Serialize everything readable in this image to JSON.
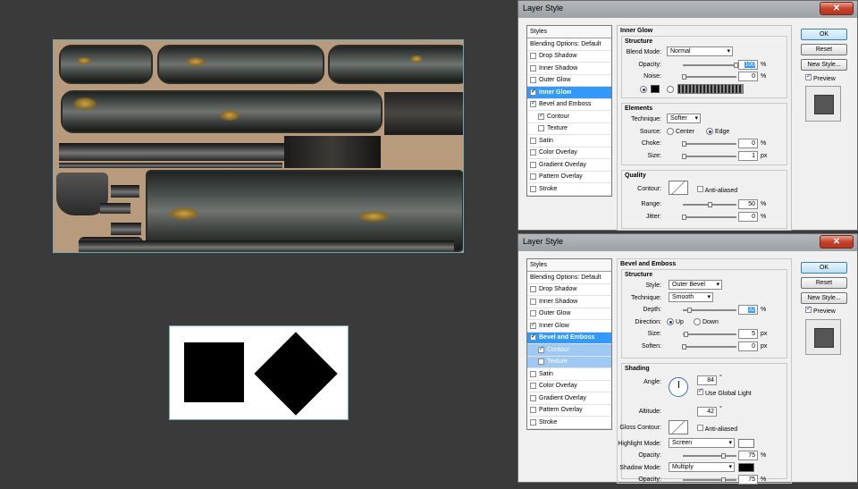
{
  "dialog1": {
    "title": "Layer Style",
    "close": "✕",
    "styles_head": "Styles",
    "items": [
      {
        "label": "Blending Options: Default",
        "check": false,
        "hascb": false
      },
      {
        "label": "Drop Shadow",
        "check": false,
        "hascb": true
      },
      {
        "label": "Inner Shadow",
        "check": false,
        "hascb": true
      },
      {
        "label": "Outer Glow",
        "check": false,
        "hascb": true
      },
      {
        "label": "Inner Glow",
        "check": true,
        "hascb": true,
        "sel": true
      },
      {
        "label": "Bevel and Emboss",
        "check": true,
        "hascb": true
      },
      {
        "label": "Contour",
        "check": true,
        "hascb": true,
        "sub": true
      },
      {
        "label": "Texture",
        "check": false,
        "hascb": true,
        "sub": true
      },
      {
        "label": "Satin",
        "check": false,
        "hascb": true
      },
      {
        "label": "Color Overlay",
        "check": false,
        "hascb": true
      },
      {
        "label": "Gradient Overlay",
        "check": false,
        "hascb": true
      },
      {
        "label": "Pattern Overlay",
        "check": false,
        "hascb": true
      },
      {
        "label": "Stroke",
        "check": false,
        "hascb": true
      }
    ],
    "section": "Inner Glow",
    "structure": "Structure",
    "blend_mode_label": "Blend Mode:",
    "blend_mode": "Normal",
    "opacity_label": "Opacity:",
    "opacity": "100",
    "noise_label": "Noise:",
    "noise": "0",
    "elements": "Elements",
    "technique_label": "Technique:",
    "technique": "Softer",
    "source_label": "Source:",
    "source_center": "Center",
    "source_edge": "Edge",
    "choke_label": "Choke:",
    "choke": "0",
    "size_label": "Size:",
    "size": "1",
    "size_unit": "px",
    "quality": "Quality",
    "contour_label": "Contour:",
    "anti_aliased": "Anti-aliased",
    "range_label": "Range:",
    "range": "50",
    "jitter_label": "Jitter:",
    "jitter": "0",
    "pct": "%",
    "ok": "OK",
    "reset": "Reset",
    "new_style": "New Style...",
    "preview": "Preview"
  },
  "dialog2": {
    "title": "Layer Style",
    "close": "✕",
    "styles_head": "Styles",
    "items": [
      {
        "label": "Blending Options: Default",
        "check": false,
        "hascb": false
      },
      {
        "label": "Drop Shadow",
        "check": false,
        "hascb": true
      },
      {
        "label": "Inner Shadow",
        "check": false,
        "hascb": true
      },
      {
        "label": "Outer Glow",
        "check": false,
        "hascb": true
      },
      {
        "label": "Inner Glow",
        "check": true,
        "hascb": true
      },
      {
        "label": "Bevel and Emboss",
        "check": true,
        "hascb": true,
        "sel": true
      },
      {
        "label": "Contour",
        "check": true,
        "hascb": true,
        "sub": true,
        "subsel": true
      },
      {
        "label": "Texture",
        "check": false,
        "hascb": true,
        "sub": true,
        "subsel": true
      },
      {
        "label": "Satin",
        "check": false,
        "hascb": true
      },
      {
        "label": "Color Overlay",
        "check": false,
        "hascb": true
      },
      {
        "label": "Gradient Overlay",
        "check": false,
        "hascb": true
      },
      {
        "label": "Pattern Overlay",
        "check": false,
        "hascb": true
      },
      {
        "label": "Stroke",
        "check": false,
        "hascb": true
      }
    ],
    "section": "Bevel and Emboss",
    "structure": "Structure",
    "style_label": "Style:",
    "style": "Outer Bevel",
    "technique_label": "Technique:",
    "technique": "Smooth",
    "depth_label": "Depth:",
    "depth": "32",
    "direction_label": "Direction:",
    "dir_up": "Up",
    "dir_down": "Down",
    "size_label": "Size:",
    "size": "5",
    "soften_label": "Soften:",
    "soften": "0",
    "px": "px",
    "shading": "Shading",
    "angle_label": "Angle:",
    "angle": "84",
    "deg": "°",
    "use_global": "Use Global Light",
    "altitude_label": "Altitude:",
    "altitude": "42",
    "gloss_label": "Gloss Contour:",
    "anti_aliased": "Anti-aliased",
    "highlight_label": "Highlight Mode:",
    "highlight": "Screen",
    "h_opacity_label": "Opacity:",
    "h_opacity": "75",
    "shadow_label": "Shadow Mode:",
    "shadow": "Multiply",
    "s_opacity_label": "Opacity:",
    "s_opacity": "75",
    "pct": "%",
    "ok": "OK",
    "reset": "Reset",
    "new_style": "New Style...",
    "preview": "Preview"
  }
}
